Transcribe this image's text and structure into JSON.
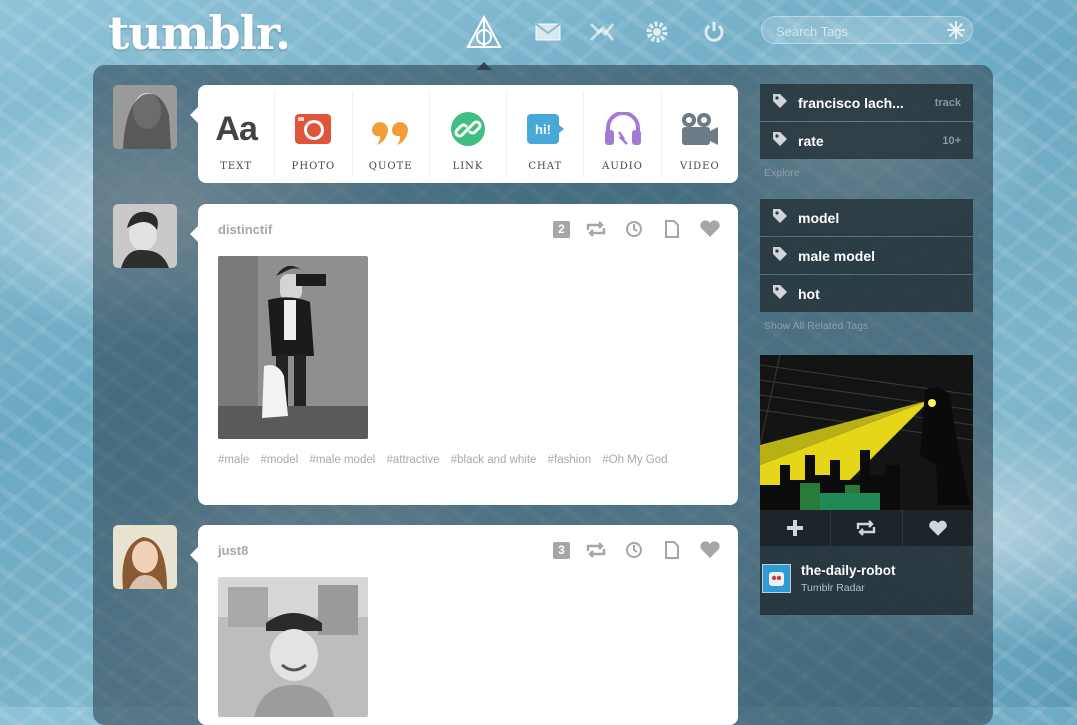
{
  "header": {
    "logo": "tumblr.",
    "nav": [
      {
        "name": "dashboard-icon"
      },
      {
        "name": "messages-icon"
      },
      {
        "name": "activity-icon"
      },
      {
        "name": "settings-icon"
      },
      {
        "name": "logout-icon"
      }
    ],
    "search_placeholder": "Search Tags"
  },
  "compose": [
    {
      "label": "TEXT",
      "icon": "text-icon",
      "color": "#444444"
    },
    {
      "label": "PHOTO",
      "icon": "camera-icon",
      "color": "#e0553a"
    },
    {
      "label": "QUOTE",
      "icon": "quote-icon",
      "color": "#f29d38"
    },
    {
      "label": "LINK",
      "icon": "link-icon",
      "color": "#3fbf83"
    },
    {
      "label": "CHAT",
      "icon": "chat-icon",
      "color": "#46a9d9"
    },
    {
      "label": "AUDIO",
      "icon": "headphones-icon",
      "color": "#a27bd6"
    },
    {
      "label": "VIDEO",
      "icon": "video-camera-icon",
      "color": "#6d7b87"
    }
  ],
  "posts": [
    {
      "author": "distinctif",
      "note_count": "2",
      "tags": [
        "#male",
        "#model",
        "#male model",
        "#attractive",
        "#black and white",
        "#fashion",
        "#Oh My God"
      ]
    },
    {
      "author": "just8",
      "note_count": "3"
    }
  ],
  "sidebar": {
    "tracked": [
      {
        "label": "francisco lach...",
        "meta": "track"
      },
      {
        "label": "rate",
        "meta": "10+"
      }
    ],
    "explore_label": "Explore",
    "related": [
      {
        "label": "model"
      },
      {
        "label": "male model"
      },
      {
        "label": "hot"
      }
    ],
    "show_related_label": "Show All Related Tags",
    "radar": {
      "author": "the-daily-robot",
      "subtitle": "Tumblr Radar"
    }
  },
  "colors": {
    "panel": "#283c48",
    "tag_text": "#a8a8a8",
    "accent_white": "#ffffff"
  }
}
